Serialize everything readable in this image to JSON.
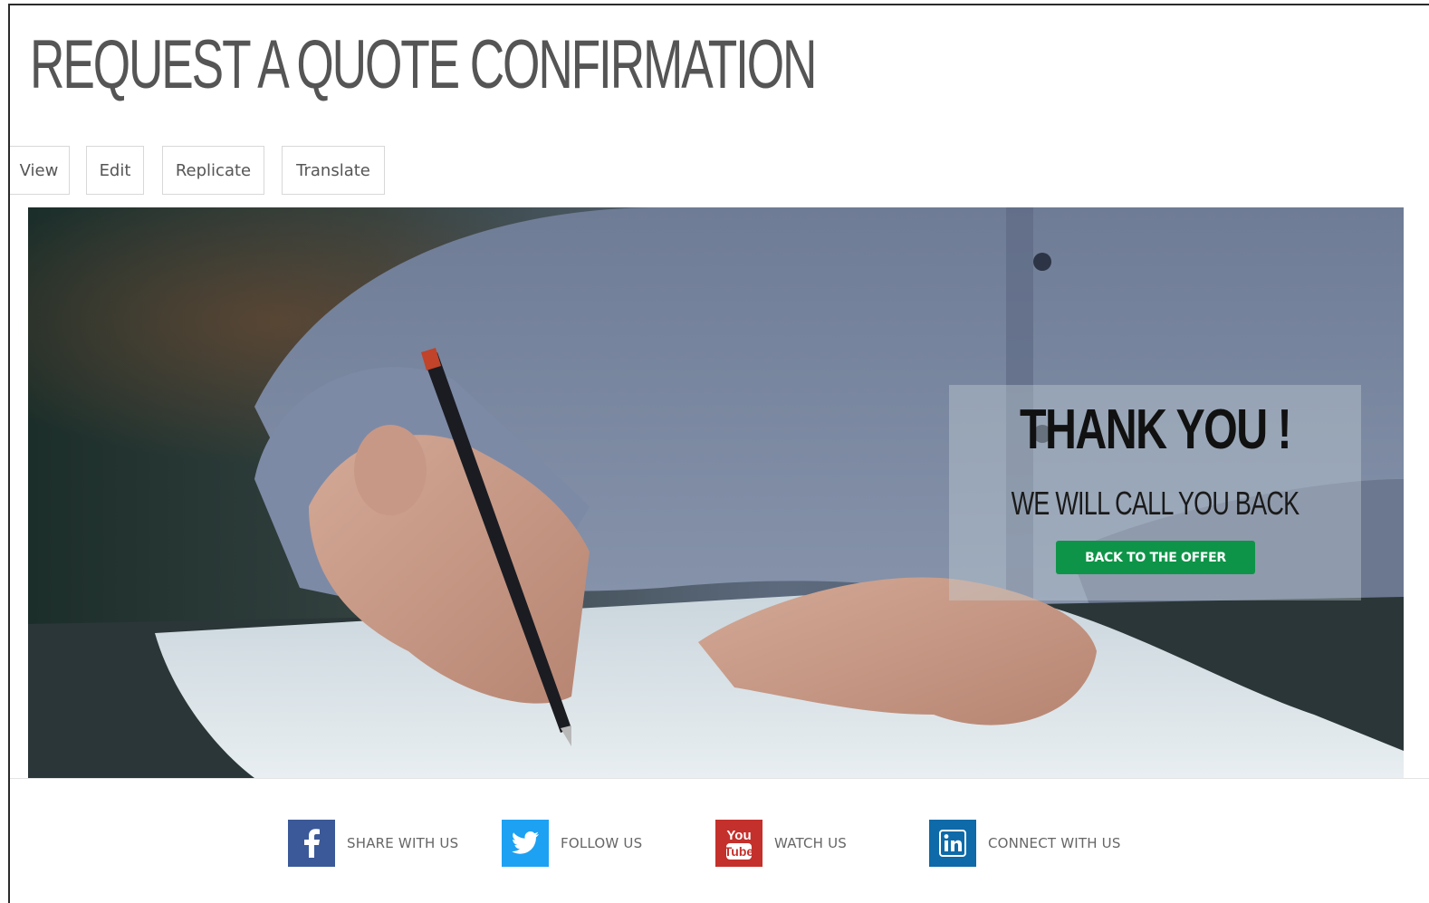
{
  "page": {
    "title": "REQUEST A QUOTE CONFIRMATION"
  },
  "tabs": [
    {
      "label": "View"
    },
    {
      "label": "Edit"
    },
    {
      "label": "Replicate"
    },
    {
      "label": "Translate"
    }
  ],
  "hero": {
    "heading": "THANK YOU !",
    "subheading": "WE WILL CALL YOU BACK",
    "button_label": "BACK TO THE OFFER"
  },
  "social": [
    {
      "label": "SHARE WITH US",
      "icon": "facebook-icon",
      "color": "#3b5998"
    },
    {
      "label": "FOLLOW US",
      "icon": "twitter-icon",
      "color": "#1da1f2"
    },
    {
      "label": "WATCH US",
      "icon": "youtube-icon",
      "color": "#c4302b"
    },
    {
      "label": "CONNECT WITH US",
      "icon": "linkedin-icon",
      "color": "#0e6aa8"
    }
  ],
  "colors": {
    "accent_green": "#0e9448",
    "title_gray": "#555555"
  }
}
